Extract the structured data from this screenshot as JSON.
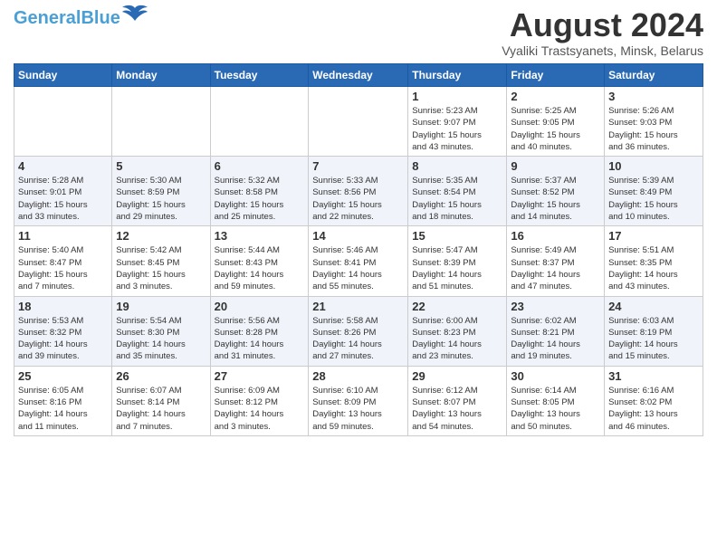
{
  "header": {
    "logo_general": "General",
    "logo_blue": "Blue",
    "month_year": "August 2024",
    "location": "Vyaliki Trastsyanets, Minsk, Belarus"
  },
  "weekdays": [
    "Sunday",
    "Monday",
    "Tuesday",
    "Wednesday",
    "Thursday",
    "Friday",
    "Saturday"
  ],
  "weeks": [
    [
      {
        "day": "",
        "info": ""
      },
      {
        "day": "",
        "info": ""
      },
      {
        "day": "",
        "info": ""
      },
      {
        "day": "",
        "info": ""
      },
      {
        "day": "1",
        "info": "Sunrise: 5:23 AM\nSunset: 9:07 PM\nDaylight: 15 hours\nand 43 minutes."
      },
      {
        "day": "2",
        "info": "Sunrise: 5:25 AM\nSunset: 9:05 PM\nDaylight: 15 hours\nand 40 minutes."
      },
      {
        "day": "3",
        "info": "Sunrise: 5:26 AM\nSunset: 9:03 PM\nDaylight: 15 hours\nand 36 minutes."
      }
    ],
    [
      {
        "day": "4",
        "info": "Sunrise: 5:28 AM\nSunset: 9:01 PM\nDaylight: 15 hours\nand 33 minutes."
      },
      {
        "day": "5",
        "info": "Sunrise: 5:30 AM\nSunset: 8:59 PM\nDaylight: 15 hours\nand 29 minutes."
      },
      {
        "day": "6",
        "info": "Sunrise: 5:32 AM\nSunset: 8:58 PM\nDaylight: 15 hours\nand 25 minutes."
      },
      {
        "day": "7",
        "info": "Sunrise: 5:33 AM\nSunset: 8:56 PM\nDaylight: 15 hours\nand 22 minutes."
      },
      {
        "day": "8",
        "info": "Sunrise: 5:35 AM\nSunset: 8:54 PM\nDaylight: 15 hours\nand 18 minutes."
      },
      {
        "day": "9",
        "info": "Sunrise: 5:37 AM\nSunset: 8:52 PM\nDaylight: 15 hours\nand 14 minutes."
      },
      {
        "day": "10",
        "info": "Sunrise: 5:39 AM\nSunset: 8:49 PM\nDaylight: 15 hours\nand 10 minutes."
      }
    ],
    [
      {
        "day": "11",
        "info": "Sunrise: 5:40 AM\nSunset: 8:47 PM\nDaylight: 15 hours\nand 7 minutes."
      },
      {
        "day": "12",
        "info": "Sunrise: 5:42 AM\nSunset: 8:45 PM\nDaylight: 15 hours\nand 3 minutes."
      },
      {
        "day": "13",
        "info": "Sunrise: 5:44 AM\nSunset: 8:43 PM\nDaylight: 14 hours\nand 59 minutes."
      },
      {
        "day": "14",
        "info": "Sunrise: 5:46 AM\nSunset: 8:41 PM\nDaylight: 14 hours\nand 55 minutes."
      },
      {
        "day": "15",
        "info": "Sunrise: 5:47 AM\nSunset: 8:39 PM\nDaylight: 14 hours\nand 51 minutes."
      },
      {
        "day": "16",
        "info": "Sunrise: 5:49 AM\nSunset: 8:37 PM\nDaylight: 14 hours\nand 47 minutes."
      },
      {
        "day": "17",
        "info": "Sunrise: 5:51 AM\nSunset: 8:35 PM\nDaylight: 14 hours\nand 43 minutes."
      }
    ],
    [
      {
        "day": "18",
        "info": "Sunrise: 5:53 AM\nSunset: 8:32 PM\nDaylight: 14 hours\nand 39 minutes."
      },
      {
        "day": "19",
        "info": "Sunrise: 5:54 AM\nSunset: 8:30 PM\nDaylight: 14 hours\nand 35 minutes."
      },
      {
        "day": "20",
        "info": "Sunrise: 5:56 AM\nSunset: 8:28 PM\nDaylight: 14 hours\nand 31 minutes."
      },
      {
        "day": "21",
        "info": "Sunrise: 5:58 AM\nSunset: 8:26 PM\nDaylight: 14 hours\nand 27 minutes."
      },
      {
        "day": "22",
        "info": "Sunrise: 6:00 AM\nSunset: 8:23 PM\nDaylight: 14 hours\nand 23 minutes."
      },
      {
        "day": "23",
        "info": "Sunrise: 6:02 AM\nSunset: 8:21 PM\nDaylight: 14 hours\nand 19 minutes."
      },
      {
        "day": "24",
        "info": "Sunrise: 6:03 AM\nSunset: 8:19 PM\nDaylight: 14 hours\nand 15 minutes."
      }
    ],
    [
      {
        "day": "25",
        "info": "Sunrise: 6:05 AM\nSunset: 8:16 PM\nDaylight: 14 hours\nand 11 minutes."
      },
      {
        "day": "26",
        "info": "Sunrise: 6:07 AM\nSunset: 8:14 PM\nDaylight: 14 hours\nand 7 minutes."
      },
      {
        "day": "27",
        "info": "Sunrise: 6:09 AM\nSunset: 8:12 PM\nDaylight: 14 hours\nand 3 minutes."
      },
      {
        "day": "28",
        "info": "Sunrise: 6:10 AM\nSunset: 8:09 PM\nDaylight: 13 hours\nand 59 minutes."
      },
      {
        "day": "29",
        "info": "Sunrise: 6:12 AM\nSunset: 8:07 PM\nDaylight: 13 hours\nand 54 minutes."
      },
      {
        "day": "30",
        "info": "Sunrise: 6:14 AM\nSunset: 8:05 PM\nDaylight: 13 hours\nand 50 minutes."
      },
      {
        "day": "31",
        "info": "Sunrise: 6:16 AM\nSunset: 8:02 PM\nDaylight: 13 hours\nand 46 minutes."
      }
    ]
  ]
}
